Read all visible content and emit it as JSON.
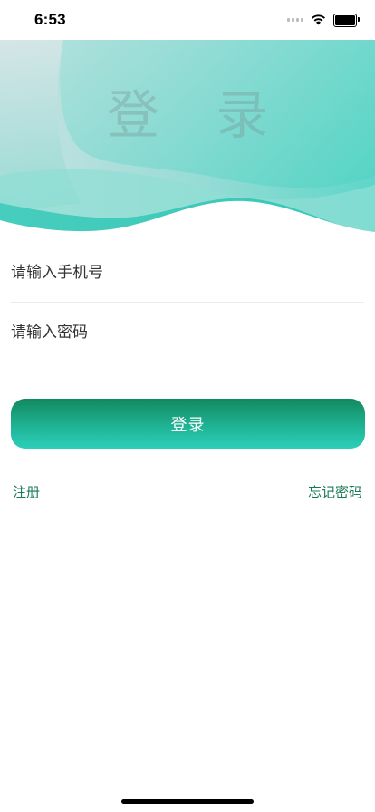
{
  "status_bar": {
    "time": "6:53"
  },
  "header": {
    "title": "登 录"
  },
  "form": {
    "phone_placeholder": "请输入手机号",
    "password_placeholder": "请输入密码",
    "login_label": "登录"
  },
  "links": {
    "register": "注册",
    "forgot_password": "忘记密码"
  },
  "colors": {
    "accent": "#1fb394",
    "link": "#1a7a55",
    "wave_light": "#c7e4e2",
    "wave_mid": "#7fd8cf",
    "wave_dark": "#35c9b8"
  }
}
